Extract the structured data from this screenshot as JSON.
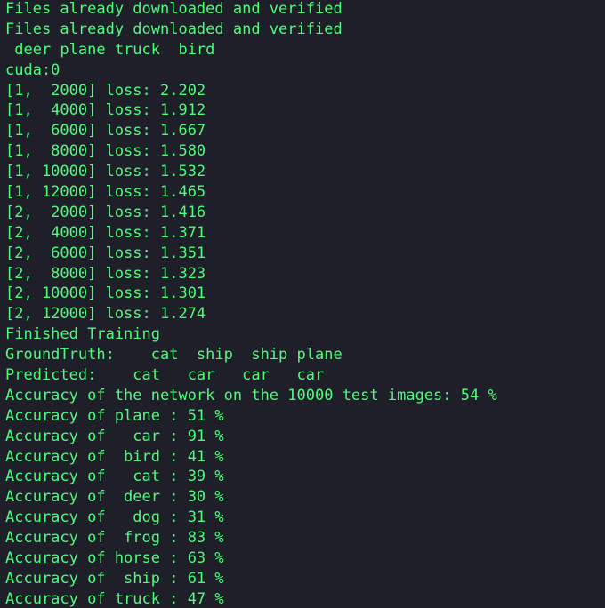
{
  "terminal": {
    "text_color": "#50fa7b",
    "background": "#1e1f29",
    "lines": [
      "Files already downloaded and verified",
      "Files already downloaded and verified",
      " deer plane truck  bird",
      "cuda:0",
      "[1,  2000] loss: 2.202",
      "[1,  4000] loss: 1.912",
      "[1,  6000] loss: 1.667",
      "[1,  8000] loss: 1.580",
      "[1, 10000] loss: 1.532",
      "[1, 12000] loss: 1.465",
      "[2,  2000] loss: 1.416",
      "[2,  4000] loss: 1.371",
      "[2,  6000] loss: 1.351",
      "[2,  8000] loss: 1.323",
      "[2, 10000] loss: 1.301",
      "[2, 12000] loss: 1.274",
      "Finished Training",
      "GroundTruth:    cat  ship  ship plane",
      "Predicted:    cat   car   car   car",
      "Accuracy of the network on the 10000 test images: 54 %",
      "Accuracy of plane : 51 %",
      "Accuracy of   car : 91 %",
      "Accuracy of  bird : 41 %",
      "Accuracy of   cat : 39 %",
      "Accuracy of  deer : 30 %",
      "Accuracy of   dog : 31 %",
      "Accuracy of  frog : 83 %",
      "Accuracy of horse : 63 %",
      "Accuracy of  ship : 61 %",
      "Accuracy of truck : 47 %"
    ]
  }
}
